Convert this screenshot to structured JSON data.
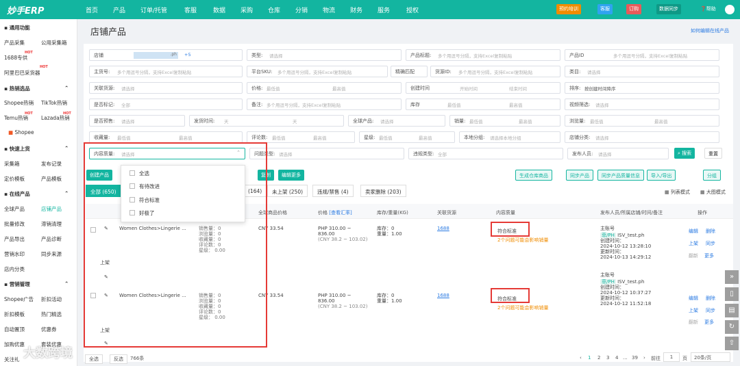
{
  "header": {
    "logo": "妙手ERP",
    "nav": [
      "首页",
      "产品",
      "订单/托管",
      "客服",
      "数据",
      "采购",
      "仓库",
      "分销",
      "物流",
      "财务",
      "服务",
      "授权"
    ],
    "training": "预约培训",
    "kefu": "客服",
    "order": "订购",
    "sync": "数据同步",
    "help": "帮助"
  },
  "sidebar": {
    "common": "通用功能",
    "items1": [
      "产品采集",
      "公用采集箱",
      "1688专供",
      "阿里巴巴采货器"
    ],
    "hot_title": "热销选品",
    "items2": [
      "Shopee热销",
      "TikTok热销",
      "Temu热销",
      "Lazada热销",
      "Shopee"
    ],
    "fast_title": "快速上货",
    "items3": [
      "采集箱",
      "发布记录",
      "定价模板",
      "产品模板"
    ],
    "online_title": "在线产品",
    "items4": [
      "全球产品",
      "店铺产品",
      "批量修改",
      "滞销清理",
      "产品导出",
      "产品诊断",
      "营销水印",
      "同步来源",
      "店内分类"
    ],
    "marketing_title": "营销管理",
    "items5": [
      "Shopee广告",
      "折扣活动",
      "折扣模板",
      "热门精选",
      "自动置顶",
      "优惠券",
      "加购优惠",
      "套装优惠",
      "关注礼"
    ],
    "hot_badge": "HOT"
  },
  "page": {
    "title": "店铺产品",
    "help_link": "如何编辑在线产品"
  },
  "filters": {
    "row1": [
      {
        "l": "店铺",
        "p": "",
        "extra": ".ph",
        "count": "+5"
      },
      {
        "l": "类型:",
        "p": "请选择"
      },
      {
        "l": "产品标题:",
        "p": "多个用逗号分隔，支持Excel复制粘贴"
      },
      {
        "l": "产品ID",
        "p": "多个用逗号分隔，支持Excel复制粘贴"
      }
    ],
    "row2": [
      {
        "l": "主货号:",
        "p": "多个用逗号分隔，支持Excel复制粘贴"
      },
      {
        "l": "平台SKU:",
        "p": "多个用逗号分隔，支持Excel复制粘贴"
      },
      {
        "l": "精确匹配",
        "p": ""
      },
      {
        "l": "货源ID:",
        "p": "多个用逗号分隔，支持Excel复制粘贴"
      },
      {
        "l": "类目:",
        "p": "请选择"
      }
    ],
    "row3": [
      {
        "l": "关联货源:",
        "p": "请选择"
      },
      {
        "l": "价格:",
        "p": "最低值"
      },
      {
        "l": "最高值",
        "p": ""
      },
      {
        "l": "创建时间",
        "p": "开始时间"
      },
      {
        "l": "结束时间",
        "p": ""
      },
      {
        "l": "排序:",
        "p": "按创建时间降序"
      }
    ],
    "row4": [
      {
        "l": "是否标记:",
        "p": "全部"
      },
      {
        "l": "备注:",
        "p": "多个用逗号分隔，支持Excel复制粘贴"
      },
      {
        "l": "库存",
        "p": "最低值"
      },
      {
        "l": "最高值",
        "p": ""
      },
      {
        "l": "视频筛选:",
        "p": "请选择"
      }
    ],
    "row5": [
      {
        "l": "是否预售:",
        "p": "请选择"
      },
      {
        "l": "发货时间:",
        "p": "天"
      },
      {
        "l": "天",
        "p": ""
      },
      {
        "l": "全球产品:",
        "p": "请选择"
      },
      {
        "l": "销量:",
        "p": "最低值"
      },
      {
        "l": "最高值",
        "p": ""
      },
      {
        "l": "浏览量:",
        "p": "最低值"
      },
      {
        "l": "最高值",
        "p": ""
      }
    ],
    "row6": [
      {
        "l": "收藏量:",
        "p": "最低值"
      },
      {
        "l": "最高值",
        "p": ""
      },
      {
        "l": "评论数:",
        "p": "最低值"
      },
      {
        "l": "最高值",
        "p": ""
      },
      {
        "l": "星级:",
        "p": "最低值"
      },
      {
        "l": "最高值",
        "p": ""
      },
      {
        "l": "本地分组:",
        "p": "请选择本地分组"
      },
      {
        "l": "店铺分类:",
        "p": "请选择"
      }
    ],
    "row7": [
      {
        "l": "内容质量:",
        "p": "请选择"
      },
      {
        "l": "问题类型:",
        "p": "请选择"
      },
      {
        "l": "违规类型:",
        "p": "全部"
      },
      {
        "l": "发布人员:",
        "p": "请选择"
      }
    ],
    "search": "搜索",
    "reset": "重置"
  },
  "dropdown": [
    "全选",
    "有待改进",
    "符合标准",
    "好极了"
  ],
  "actions": {
    "create": "创建产品",
    "copy": "复制",
    "edit_more": "编辑更多",
    "gen_warehouse": "生成仓库商品",
    "sync_product": "同步产品",
    "sync_quality": "同步产品质量信息",
    "import_export": "导入/导出",
    "group": "分组",
    "list_mode": "列表模式",
    "grid_mode": "大图模式"
  },
  "tabs": [
    "全部 (650)",
    "(164)",
    "未上架 (250)",
    "违规/禁售 (4)",
    "卖家删除 (203)"
  ],
  "table": {
    "headers": [
      "全球商品价格",
      "价格",
      "库存/重量(KG)",
      "关联货源",
      "内容质量",
      "发布人员/所属店铺/时间/备注",
      "操作"
    ],
    "price_link": "[查看汇率]",
    "rows": [
      {
        "title": "Women Clothes>Lingerie ...",
        "stats": [
          "销售量：0",
          "浏览量：0",
          "收藏量：0",
          "评论数：0",
          "星级：  0.00"
        ],
        "global_price": "CNY 33.54",
        "price": "PHP 310.00 ~",
        "price2": "836.00",
        "price3": "(CNY 38.2 ~ 103.02)",
        "stock": "库存：0",
        "weight": "重量：1.00",
        "source": "1688",
        "quality": "符合标准",
        "quality_note": "2个问题可能会影响销量",
        "owner": "主账号",
        "shop_tag": "菲/PH",
        "shop": "ISV_test.ph",
        "created_label": "创建时间：",
        "created": "2024-10-12 13:28:10",
        "updated_label": "更新时间：",
        "updated": "2024-10-13 14:29:12",
        "status": "上架"
      },
      {
        "title": "Women Clothes>Lingerie ...",
        "stats": [
          "销售量：0",
          "浏览量：0",
          "收藏量：0",
          "评论数：0",
          "星级：  0.00"
        ],
        "global_price": "CNY 33.54",
        "price": "PHP 310.00 ~",
        "price2": "836.00",
        "price3": "(CNY 38.2 ~ 103.02)",
        "stock": "库存：0",
        "weight": "重量：1.00",
        "source": "1688",
        "quality": "符合标准",
        "quality_note": "2个问题可能会影响销量",
        "owner": "主账号",
        "shop_tag": "菲/PH",
        "shop": "ISV_test.ph",
        "created_label": "创建时间：",
        "created": "2024-10-12 10:37:27",
        "updated_label": "更新时间：",
        "updated": "2024-10-12 11:52:18",
        "status": "上架"
      }
    ],
    "ops": {
      "edit": "编辑",
      "delete": "删除",
      "list": "上架",
      "sync": "同步",
      "translate": "翻新",
      "more": "更多"
    }
  },
  "footer": {
    "select_all": "全选",
    "invert": "反选",
    "count": "766条",
    "pages": [
      "1",
      "2",
      "3",
      "4",
      "...",
      "39"
    ],
    "goto": "前往",
    "page_input": "1",
    "page_unit": "页",
    "per_page": "20条/页"
  },
  "watermark": "大数跨境"
}
